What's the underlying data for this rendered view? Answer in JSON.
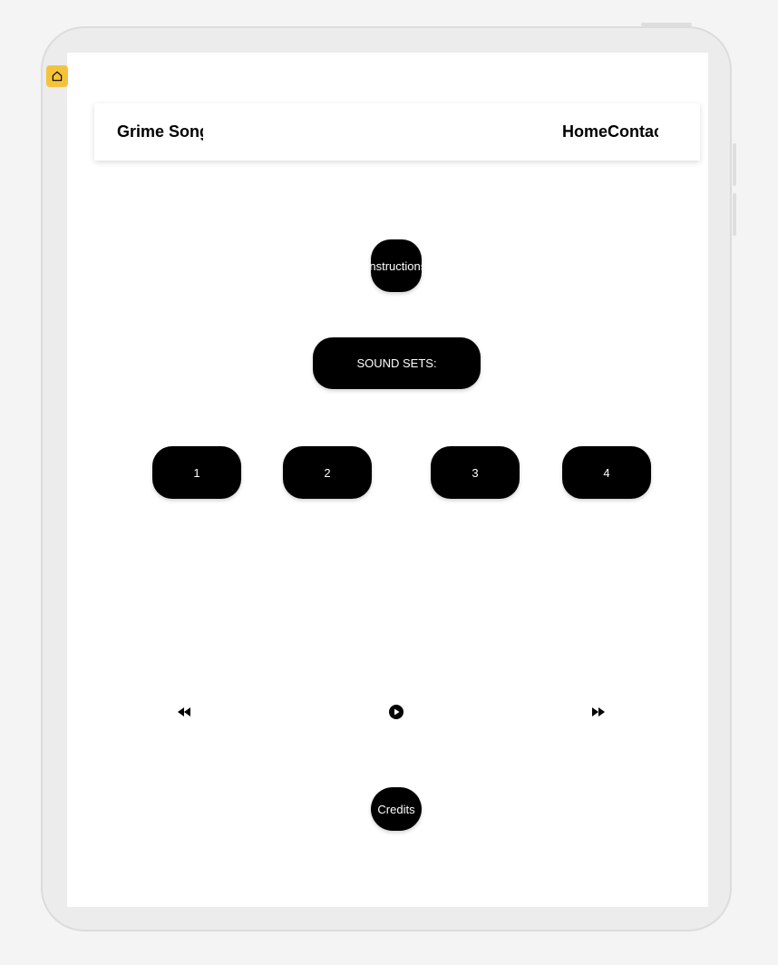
{
  "app": {
    "brand": "Grime Song",
    "nav_links": "HomeContac"
  },
  "buttons": {
    "instructions": "Instructions",
    "sound_sets": "SOUND SETS:",
    "sets": [
      "1",
      "2",
      "3",
      "4"
    ],
    "credits": "Credits"
  },
  "controls": {
    "rewind_icon": "rewind-icon",
    "play_icon": "play-icon",
    "forward_icon": "fast-forward-icon"
  },
  "colors": {
    "badge": "#f5c33b",
    "button_bg": "#000000",
    "button_text": "#ffffff"
  }
}
